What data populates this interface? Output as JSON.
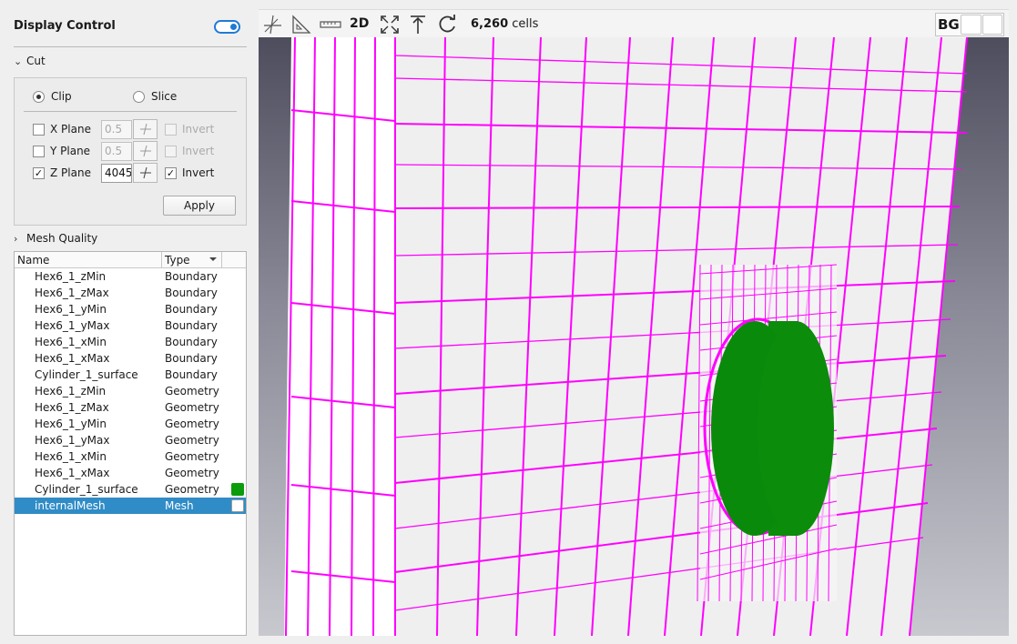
{
  "panel": {
    "title": "Display Control",
    "cut_label": "Cut",
    "clip_label": "Clip",
    "slice_label": "Slice",
    "planes": [
      {
        "label": "X Plane",
        "value": "0.5",
        "checked": false,
        "invert_label": "Invert",
        "invert": false
      },
      {
        "label": "Y Plane",
        "value": "0.5",
        "checked": false,
        "invert_label": "Invert",
        "invert": false
      },
      {
        "label": "Z Plane",
        "value": "4045",
        "checked": true,
        "invert_label": "Invert",
        "invert": true
      }
    ],
    "apply_label": "Apply",
    "mesh_quality_label": "Mesh Quality"
  },
  "table": {
    "headers": {
      "name": "Name",
      "type": "Type"
    },
    "rows": [
      {
        "name": "Hex6_1_zMin",
        "type": "Boundary"
      },
      {
        "name": "Hex6_1_zMax",
        "type": "Boundary"
      },
      {
        "name": "Hex6_1_yMin",
        "type": "Boundary"
      },
      {
        "name": "Hex6_1_yMax",
        "type": "Boundary"
      },
      {
        "name": "Hex6_1_xMin",
        "type": "Boundary"
      },
      {
        "name": "Hex6_1_xMax",
        "type": "Boundary"
      },
      {
        "name": "Cylinder_1_surface",
        "type": "Boundary"
      },
      {
        "name": "Hex6_1_zMin",
        "type": "Geometry"
      },
      {
        "name": "Hex6_1_zMax",
        "type": "Geometry"
      },
      {
        "name": "Hex6_1_yMin",
        "type": "Geometry"
      },
      {
        "name": "Hex6_1_yMax",
        "type": "Geometry"
      },
      {
        "name": "Hex6_1_xMin",
        "type": "Geometry"
      },
      {
        "name": "Hex6_1_xMax",
        "type": "Geometry"
      },
      {
        "name": "Cylinder_1_surface",
        "type": "Geometry",
        "swatch": "#0b9c0b"
      },
      {
        "name": "internalMesh",
        "type": "Mesh",
        "swatch": "#ffffff",
        "selected": true
      }
    ]
  },
  "toolbar": {
    "mode_label": "2D",
    "cells_count": "6,260",
    "cells_unit": "cells",
    "bg_label": "BG"
  },
  "colors": {
    "mesh_lines": "#ff00ff",
    "cylinder": "#0b8c0b",
    "selection": "#308cc6",
    "accent": "#1f7ad6"
  }
}
